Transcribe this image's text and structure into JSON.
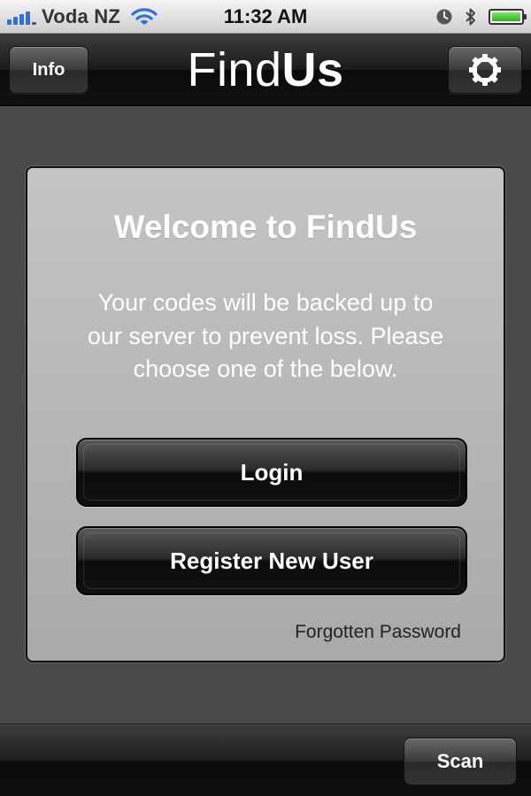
{
  "status_bar": {
    "carrier": "Voda NZ",
    "time": "11:32 AM",
    "signal_bars": 4,
    "battery_level": 1.0,
    "icons": [
      "signal-icon",
      "wifi-icon",
      "clock-icon",
      "bluetooth-icon",
      "battery-icon"
    ]
  },
  "nav": {
    "info_label": "Info",
    "brand_light": "Find",
    "brand_bold": "Us",
    "settings_icon": "gear-icon"
  },
  "panel": {
    "title": "Welcome to FindUs",
    "message": "Your codes will be backed up to our server to prevent loss. Please choose one of the below.",
    "login_label": "Login",
    "register_label": "Register New User",
    "forgot_label": "Forgotten Password"
  },
  "toolbar": {
    "scan_label": "Scan"
  },
  "colors": {
    "background": "#4a4a4a",
    "panel": "#b8b8b8",
    "button": "#111111",
    "signal": "#2f6fd6",
    "battery": "#2fb21e"
  }
}
